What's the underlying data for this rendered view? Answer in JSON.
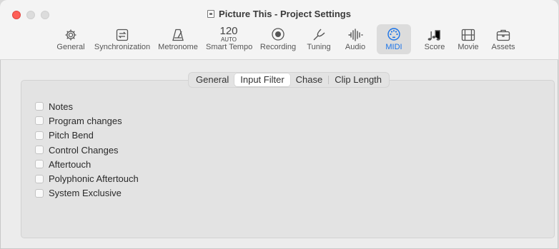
{
  "window": {
    "title": "Picture This - Project Settings"
  },
  "toolbar": {
    "items": [
      {
        "label": "General",
        "icon": "gear-icon"
      },
      {
        "label": "Synchronization",
        "icon": "sync-icon"
      },
      {
        "label": "Metronome",
        "icon": "metronome-icon"
      },
      {
        "label": "Smart Tempo",
        "icon": "tempo-display",
        "tempo_value": "120",
        "tempo_mode": "AUTO"
      },
      {
        "label": "Recording",
        "icon": "record-icon"
      },
      {
        "label": "Tuning",
        "icon": "tuning-fork-icon"
      },
      {
        "label": "Audio",
        "icon": "waveform-icon"
      },
      {
        "label": "MIDI",
        "icon": "midi-port-icon",
        "selected": true
      },
      {
        "label": "Score",
        "icon": "notes-icon"
      },
      {
        "label": "Movie",
        "icon": "film-icon"
      },
      {
        "label": "Assets",
        "icon": "briefcase-icon"
      }
    ],
    "selected_color": "#1a73e8"
  },
  "tabs": {
    "items": [
      "General",
      "Input Filter",
      "Chase",
      "Clip Length"
    ],
    "active": "Input Filter"
  },
  "filters": {
    "items": [
      {
        "label": "Notes",
        "checked": false
      },
      {
        "label": "Program changes",
        "checked": false
      },
      {
        "label": "Pitch Bend",
        "checked": false
      },
      {
        "label": "Control Changes",
        "checked": false
      },
      {
        "label": "Aftertouch",
        "checked": false
      },
      {
        "label": "Polyphonic Aftertouch",
        "checked": false
      },
      {
        "label": "System Exclusive",
        "checked": false
      }
    ]
  }
}
